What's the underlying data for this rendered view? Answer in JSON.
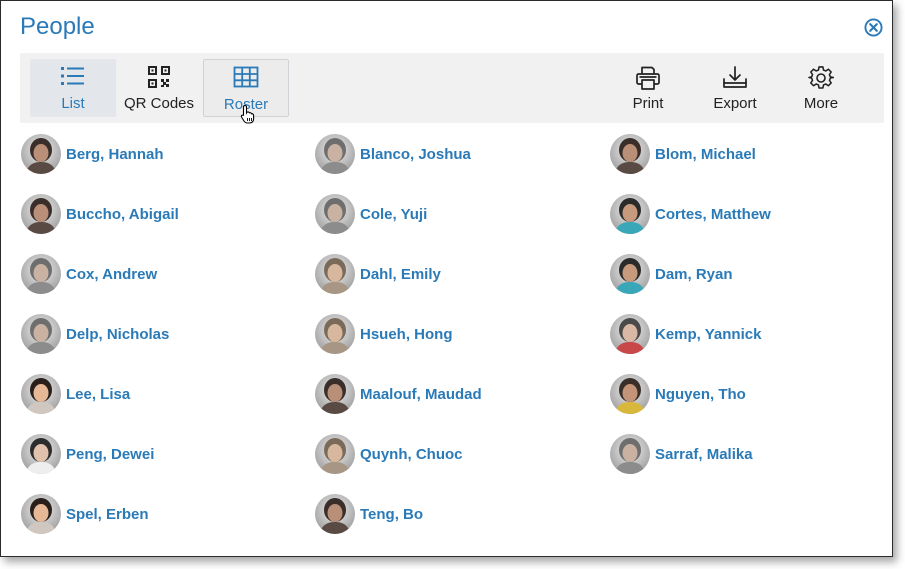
{
  "title": "People",
  "toolbar": {
    "list": "List",
    "qr_codes": "QR Codes",
    "roster": "Roster",
    "print": "Print",
    "export": "Export",
    "more": "More"
  },
  "colors": {
    "accent": "#2a7ab8",
    "toolbar_bg": "#f1f1f1"
  },
  "people": [
    {
      "name": "Berg, Hannah",
      "avatar": "dark"
    },
    {
      "name": "Blanco, Joshua",
      "avatar": "gray"
    },
    {
      "name": "Blom, Michael",
      "avatar": "dark"
    },
    {
      "name": "Buccho, Abigail",
      "avatar": "dark"
    },
    {
      "name": "Cole, Yuji",
      "avatar": "gray"
    },
    {
      "name": "Cortes, Matthew",
      "avatar": "teal"
    },
    {
      "name": "Cox, Andrew",
      "avatar": "gray"
    },
    {
      "name": "Dahl, Emily",
      "avatar": "tan"
    },
    {
      "name": "Dam, Ryan",
      "avatar": "teal"
    },
    {
      "name": "Delp, Nicholas",
      "avatar": "gray"
    },
    {
      "name": "Hsueh, Hong",
      "avatar": "tan"
    },
    {
      "name": "Kemp, Yannick",
      "avatar": "red"
    },
    {
      "name": "Lee, Lisa",
      "avatar": "face"
    },
    {
      "name": "Maalouf, Maudad",
      "avatar": "dark"
    },
    {
      "name": "Nguyen, Tho",
      "avatar": "yellow"
    },
    {
      "name": "Peng, Dewei",
      "avatar": "light"
    },
    {
      "name": "Quynh, Chuoc",
      "avatar": "tan"
    },
    {
      "name": "Sarraf, Malika",
      "avatar": "gray"
    },
    {
      "name": "Spel, Erben",
      "avatar": "face"
    },
    {
      "name": "Teng, Bo",
      "avatar": "dark"
    }
  ]
}
